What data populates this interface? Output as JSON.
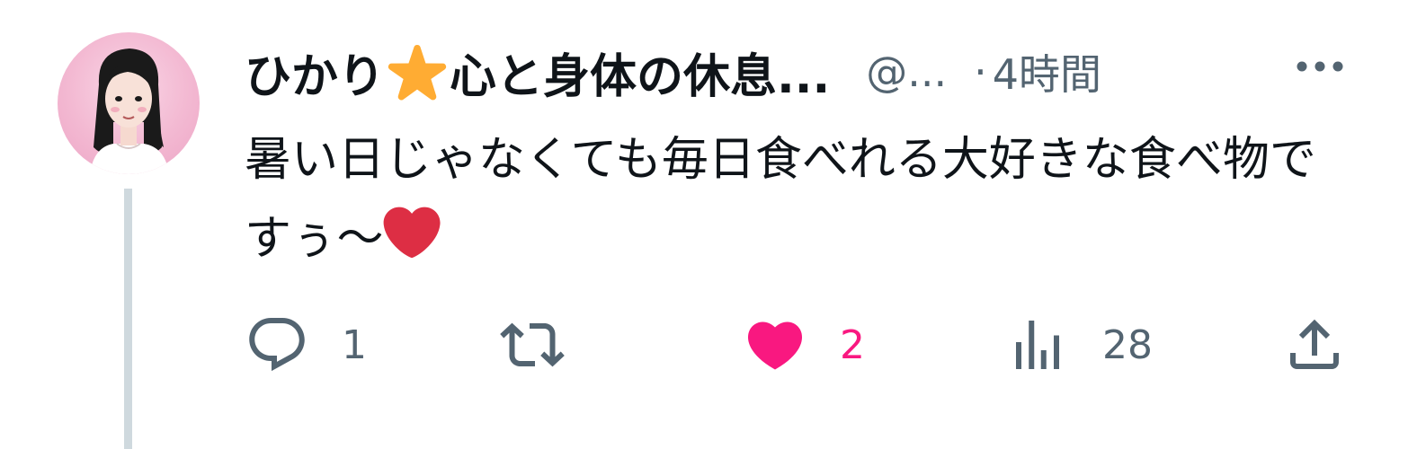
{
  "tweet": {
    "display_name": "ひかり",
    "display_name_rest": "心と身体の休息...",
    "name_emoji": "star-emoji",
    "handle": "@...",
    "separator": "·",
    "time": "4時間",
    "text": "暑い日じゃなくても毎日食べれる大好きな食べ物ですぅ〜",
    "text_emoji": "red-heart-emoji"
  },
  "actions": {
    "reply": {
      "icon": "reply-icon",
      "count": "1"
    },
    "retweet": {
      "icon": "retweet-icon",
      "count": ""
    },
    "like": {
      "icon": "heart-icon",
      "count": "2",
      "liked": true
    },
    "views": {
      "icon": "views-icon",
      "count": "28"
    },
    "share": {
      "icon": "share-icon"
    }
  },
  "colors": {
    "text": "#0f1419",
    "secondary": "#536471",
    "like": "#f91880",
    "thread_line": "#cfd9de",
    "star": "#ffac33",
    "heart_emoji": "#dd2e44"
  }
}
